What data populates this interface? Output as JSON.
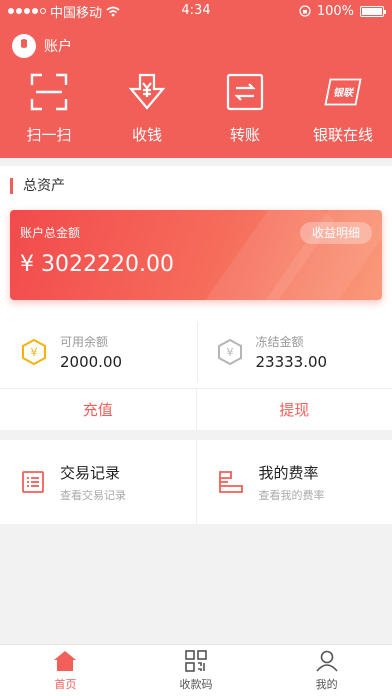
{
  "status_bar": {
    "carrier": "中国移动",
    "time": "4:34",
    "battery": "100%",
    "battery_level": 1.0
  },
  "account": {
    "label": "账户"
  },
  "actions": [
    {
      "label": "扫一扫",
      "icon": "scan-icon"
    },
    {
      "label": "收钱",
      "icon": "receive-money-icon"
    },
    {
      "label": "转账",
      "icon": "transfer-icon"
    },
    {
      "label": "银联在线",
      "icon": "unionpay-icon",
      "icon_text": "银联"
    }
  ],
  "assets": {
    "title": "总资产",
    "card_label": "账户总金额",
    "amount": "¥ 3022220.00",
    "detail_button": "收益明细"
  },
  "funds": {
    "available": {
      "label": "可用余额",
      "value": "2000.00",
      "icon_glyph": "¥"
    },
    "frozen": {
      "label": "冻结金额",
      "value": "23333.00",
      "icon_glyph": "¥"
    }
  },
  "operations": {
    "recharge": "充值",
    "withdraw": "提现"
  },
  "records": {
    "transactions": {
      "title": "交易记录",
      "subtitle": "查看交易记录"
    },
    "rates": {
      "title": "我的费率",
      "subtitle": "查看我的费率"
    }
  },
  "tabbar": [
    {
      "label": "首页",
      "active": true
    },
    {
      "label": "收款码",
      "active": false
    },
    {
      "label": "我的",
      "active": false
    }
  ],
  "colors": {
    "accent": "#f25f59",
    "available_icon": "#f5b30a",
    "frozen_icon": "#b5b5b5"
  }
}
